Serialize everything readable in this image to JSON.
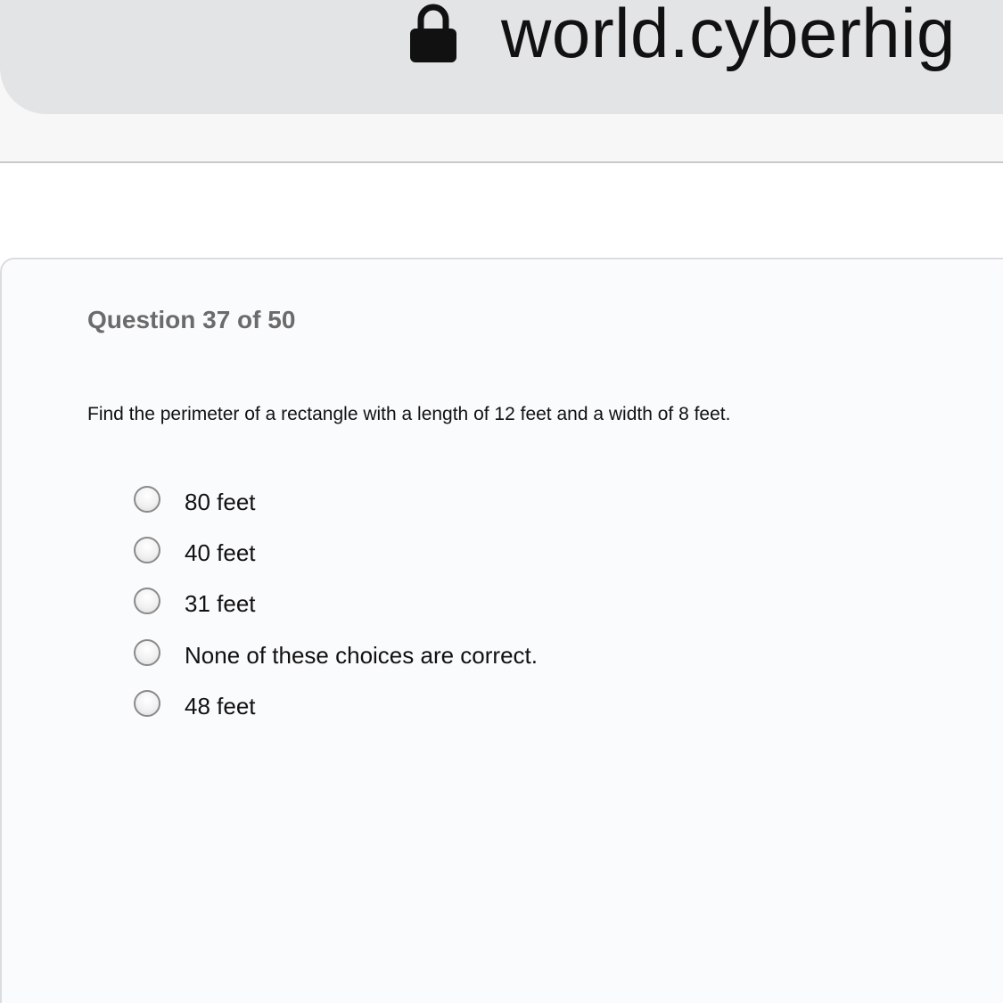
{
  "browser": {
    "url": "world.cyberhig",
    "lock_icon": "lock-icon"
  },
  "quiz": {
    "counter": "Question 37 of 50",
    "question": "Find the perimeter of a rectangle with a length of 12 feet and a width of 8 feet.",
    "options": [
      {
        "label": "80 feet",
        "selected": false
      },
      {
        "label": "40 feet",
        "selected": false
      },
      {
        "label": "31 feet",
        "selected": false
      },
      {
        "label": "None of these choices are correct.",
        "selected": false
      },
      {
        "label": "48 feet",
        "selected": false
      }
    ]
  },
  "colors": {
    "address_bar": "#e3e4e6",
    "card_background": "#fafbfc",
    "counter_text": "#6b6b6b",
    "body_text": "#111111"
  }
}
